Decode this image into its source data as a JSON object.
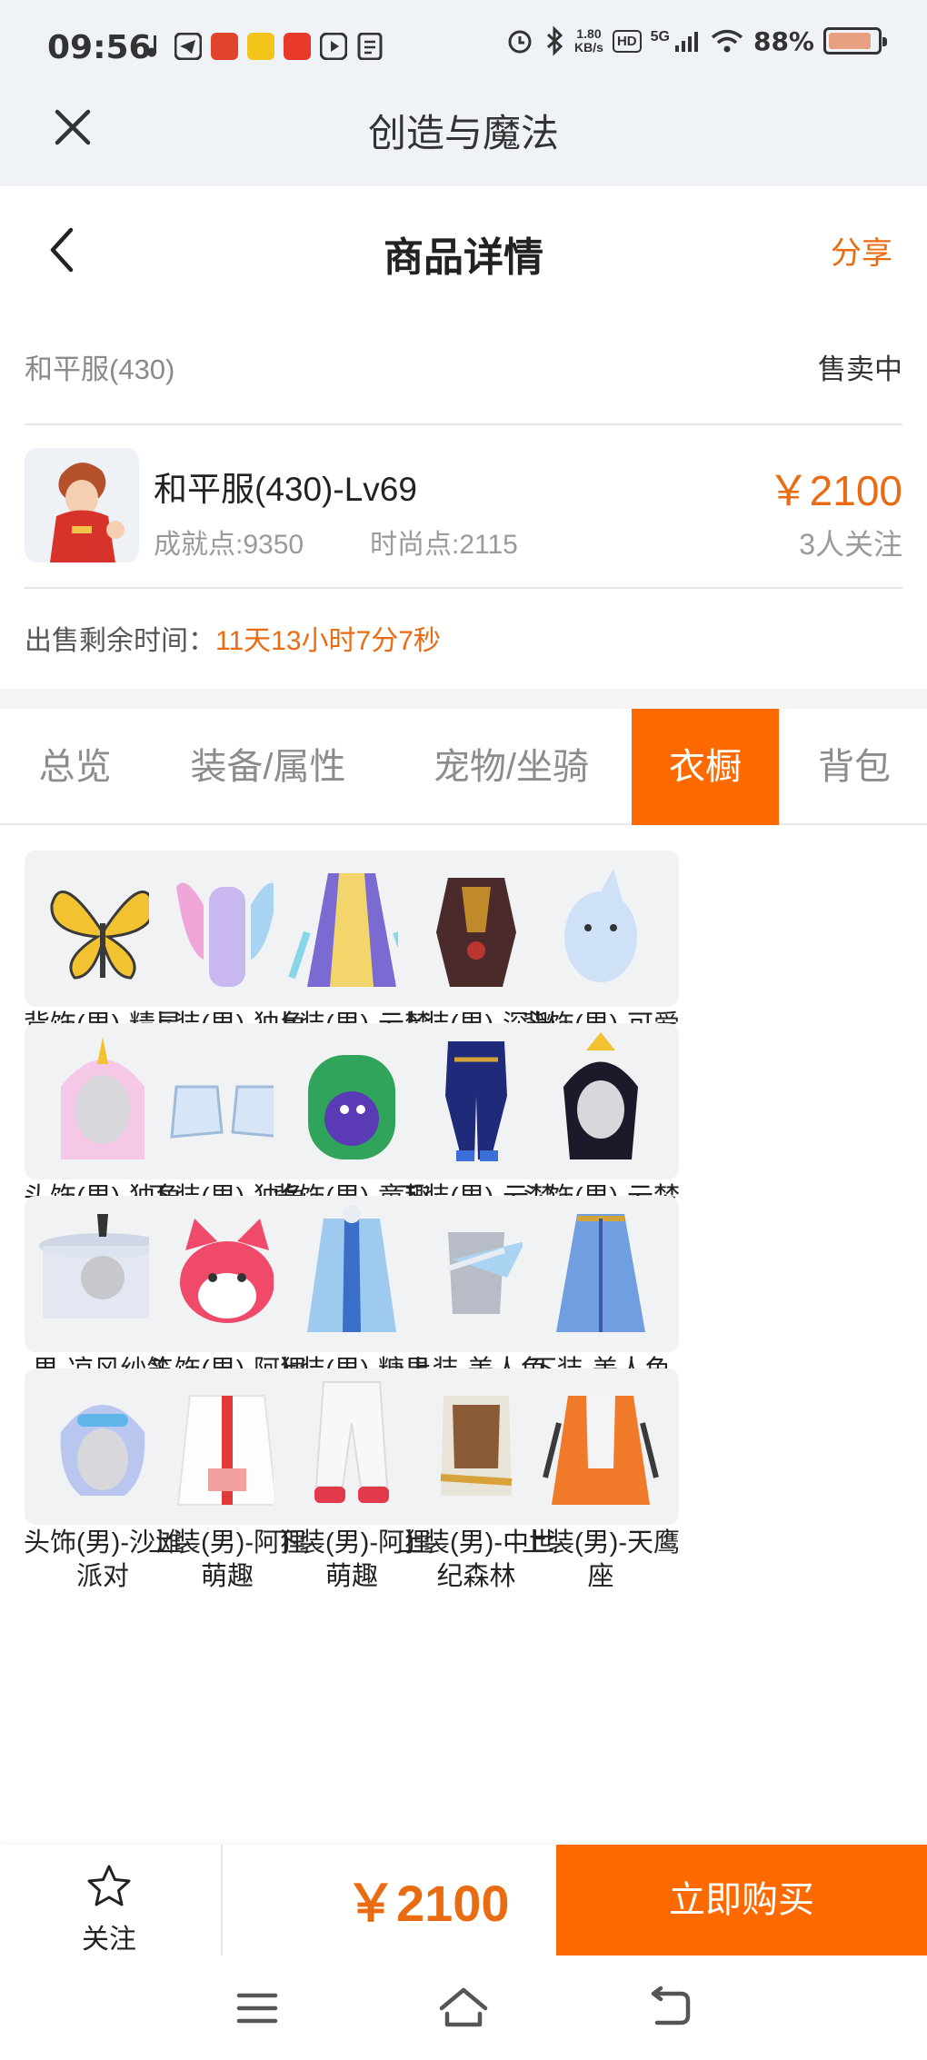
{
  "status_bar": {
    "time": "09:56",
    "net_speed_value": "1.80",
    "net_speed_unit": "KB/s",
    "hd": "HD",
    "network": "5G",
    "battery": "88%",
    "battery_level": 0.88
  },
  "app_header": {
    "title": "创造与魔法"
  },
  "page_header": {
    "title": "商品详情",
    "share": "分享"
  },
  "product": {
    "server": "和平服(430)",
    "status": "售卖中",
    "name": "和平服(430)-Lv69",
    "achievement": "成就点:9350",
    "fashion": "时尚点:2115",
    "price": "￥2100",
    "followers": "3人关注",
    "remaining_label": "出售剩余时间：",
    "remaining_time": "11天13小时7分7秒"
  },
  "tabs": [
    "总览",
    "装备/属性",
    "宠物/坐骑",
    "衣橱",
    "背包"
  ],
  "active_tab": "衣橱",
  "wardrobe": [
    {
      "label": "背饰(男)-精灵翅膀",
      "icon": "butterfly-wings-icon"
    },
    {
      "label": "上装(男)-独角兽",
      "icon": "unicorn-top-icon"
    },
    {
      "label": "上装(男)-云梦春华",
      "icon": "robe-icon"
    },
    {
      "label": "上装(男)-深渊盔甲",
      "icon": "armor-icon"
    },
    {
      "label": "背饰(男)-可爱鲨鱼",
      "icon": "shark-icon"
    },
    {
      "label": "头饰(男)-独角兽",
      "icon": "unicorn-hood-icon"
    },
    {
      "label": "下装(男)-独角兽",
      "icon": "boots-icon"
    },
    {
      "label": "背饰(男)-童趣书包",
      "icon": "backpack-icon"
    },
    {
      "label": "下装(男)-云梦春华",
      "icon": "pants-icon"
    },
    {
      "label": "头饰(男)-云梦春华",
      "icon": "hairpiece-icon"
    },
    {
      "label": "男-凉风纱笠",
      "icon": "veil-hat-icon"
    },
    {
      "label": "头饰(男)-阿狸",
      "icon": "fox-head-icon"
    },
    {
      "label": "上装(男)-糖果王子",
      "icon": "prince-coat-icon"
    },
    {
      "label": "上装-美人鱼上装",
      "icon": "mermaid-top-icon"
    },
    {
      "label": "下装-美人鱼下装",
      "icon": "mermaid-skirt-icon"
    },
    {
      "label": "头饰(男)-沙滩派对",
      "icon": "beach-hair-icon"
    },
    {
      "label": "上装(男)-阿狸萌趣",
      "icon": "fox-jacket-icon"
    },
    {
      "label": "下装(男)-阿狸萌趣",
      "icon": "white-pants-icon"
    },
    {
      "label": "上装(男)-中世纪森林",
      "icon": "medieval-top-icon"
    },
    {
      "label": "上装(男)-天鹰座",
      "icon": "eagle-top-icon"
    }
  ],
  "bottom_bar": {
    "follow": "关注",
    "price": "￥2100",
    "buy": "立即购买"
  },
  "colors": {
    "accent": "#ff6a00",
    "price": "#ea6c12"
  }
}
